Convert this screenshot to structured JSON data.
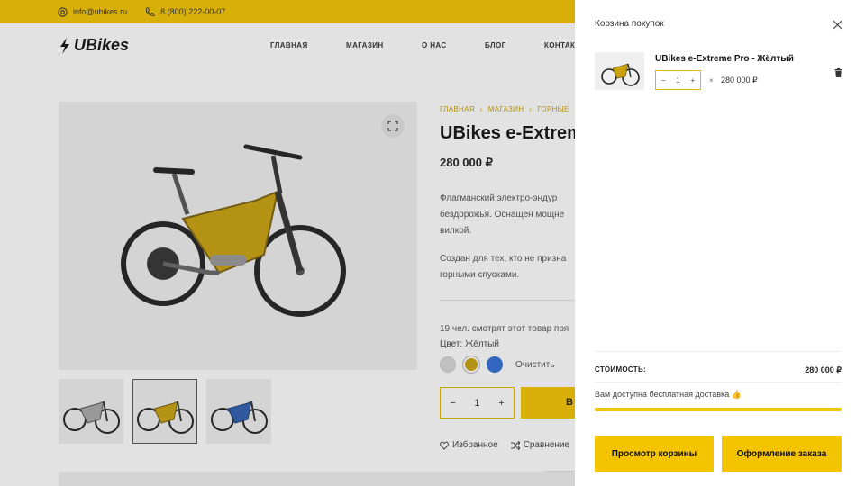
{
  "topbar": {
    "email": "info@ubikes.ru",
    "phone": "8 (800) 222-00-07"
  },
  "header": {
    "logo": "UBikes",
    "nav": [
      "ГЛАВНАЯ",
      "МАГАЗИН",
      "О НАС",
      "БЛОГ",
      "КОНТАК"
    ]
  },
  "product": {
    "breadcrumb": [
      "ГЛАВНАЯ",
      "›",
      "МАГАЗИН",
      "›",
      "ГОРНЫЕ"
    ],
    "title": "UBikes e-Extrem",
    "price": "280 000 ₽",
    "description": [
      "Флагманский электро-эндур",
      "бездорожья. Оснащен мощне",
      "вилкой."
    ],
    "description2": [
      "Создан для тех, кто не призна",
      "горными спусками."
    ],
    "viewers": "19 чел. смотрят этот товар пря",
    "color_label": "Цвет: Жёлтый",
    "clear_label": "Очистить",
    "qty": "1",
    "buy_label": "В",
    "wishlist_label": "Избранное",
    "compare_label": "Сравнение",
    "swatch_colors": [
      "#d8d8d8",
      "#c9a20d",
      "#2f6fd6"
    ]
  },
  "cart": {
    "title": "Корзина покупок",
    "item": {
      "name": "UBikes e-Extreme Pro - Жёлтый",
      "qty": "1",
      "minus": "−",
      "plus": "+",
      "times": "×",
      "price": "280 000 ₽"
    },
    "total_label": "СТОИМОСТЬ:",
    "total_value": "280 000 ₽",
    "free_shipping": "Вам доступна бесплатная доставка 👍",
    "shipping_progress": 1.0,
    "view_cart_label": "Просмотр корзины",
    "checkout_label": "Оформление заказа"
  },
  "colors": {
    "accent": "#f5c400",
    "bike_frame": "#c9a20d"
  }
}
